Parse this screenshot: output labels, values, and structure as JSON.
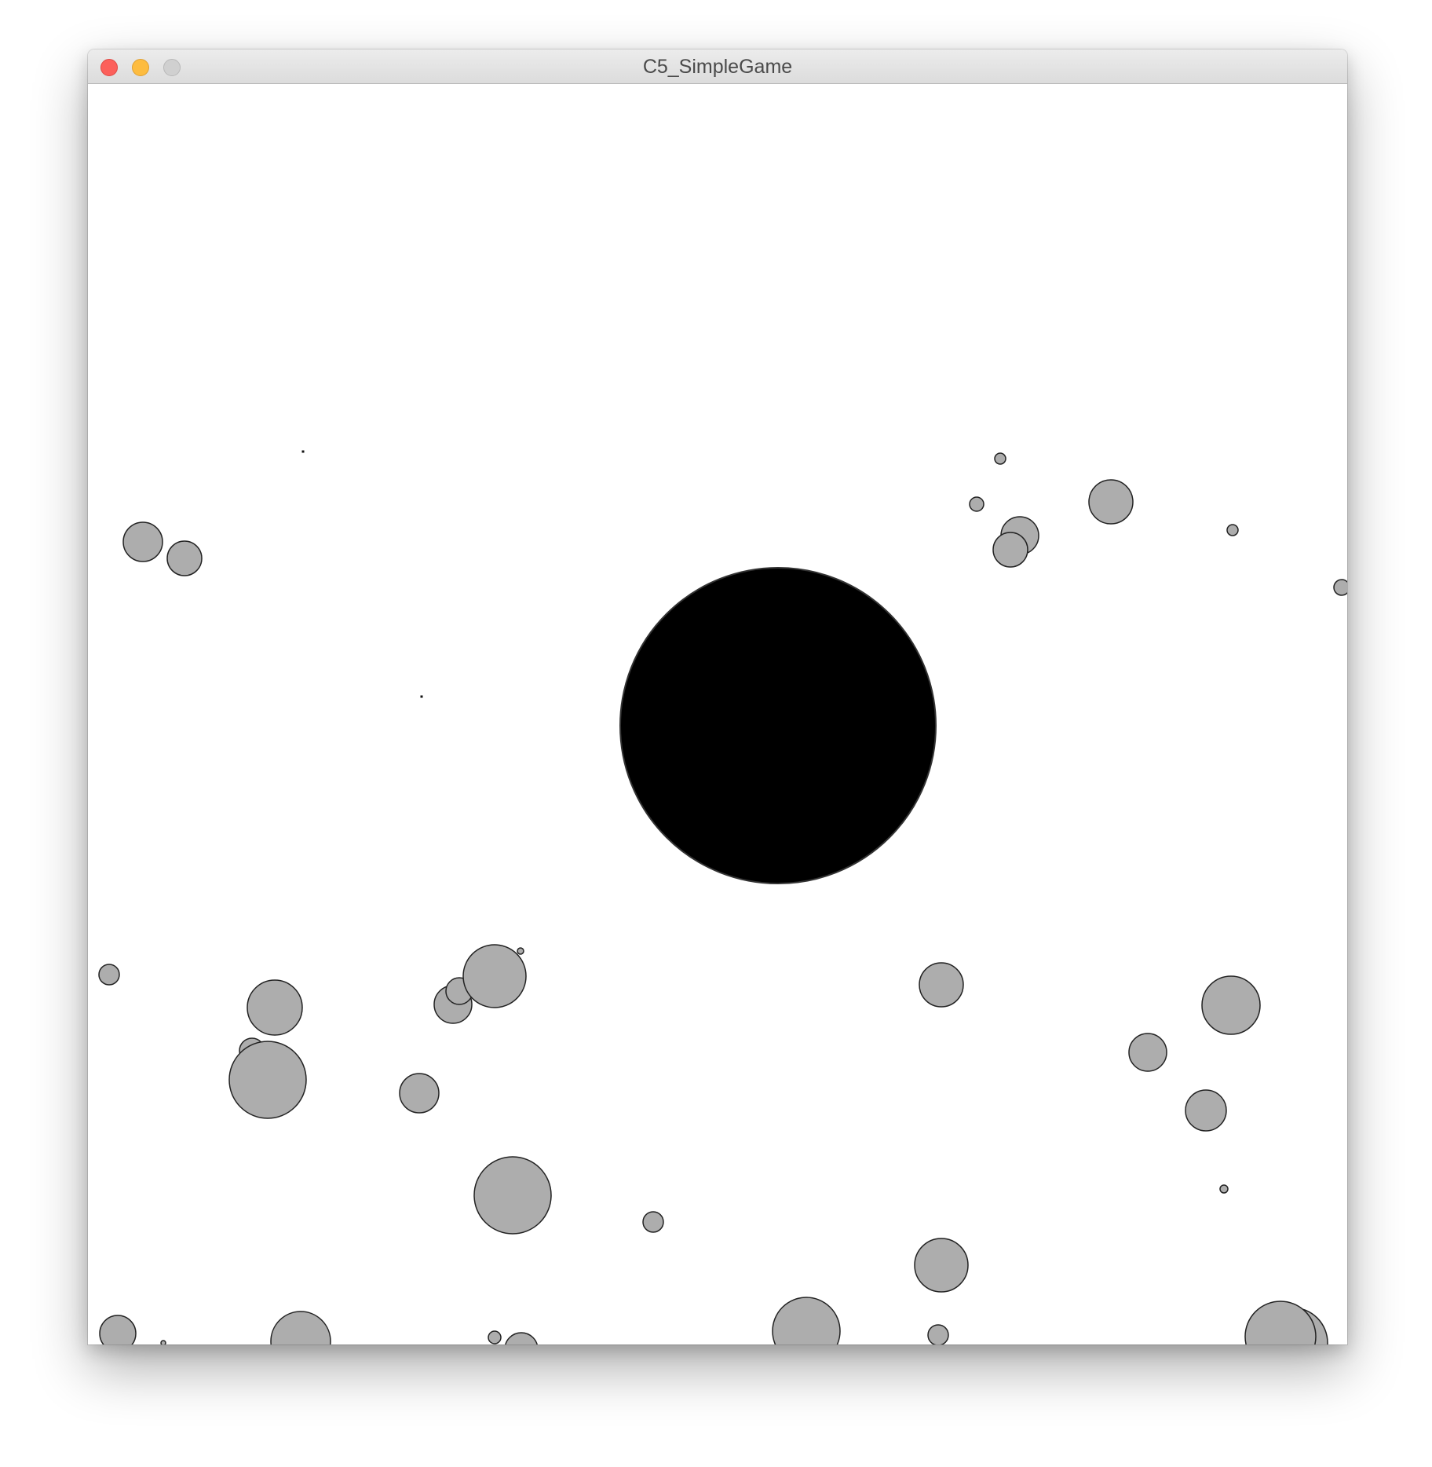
{
  "window": {
    "title": "C5_SimpleGame"
  },
  "game": {
    "background": "#ffffff",
    "player": {
      "fill": "#000000",
      "stroke": "#333333"
    },
    "particle": {
      "fill": "#adadad",
      "stroke": "#222222"
    }
  }
}
